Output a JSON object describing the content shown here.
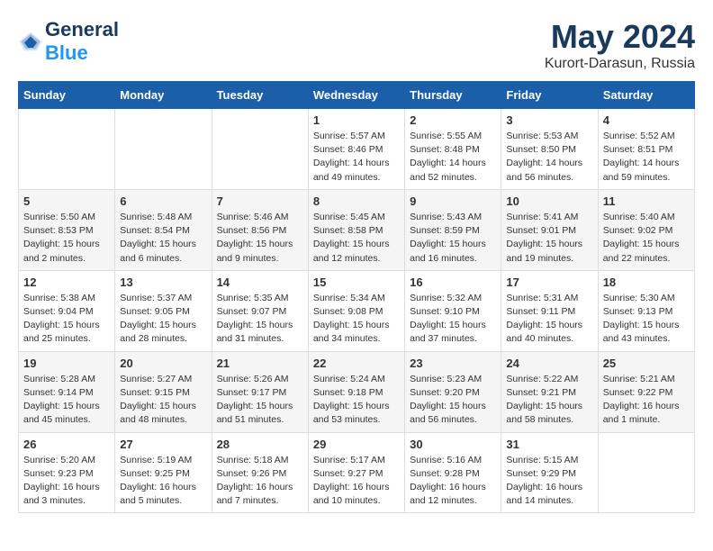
{
  "logo": {
    "text_general": "General",
    "text_blue": "Blue"
  },
  "title": "May 2024",
  "location": "Kurort-Darasun, Russia",
  "weekdays": [
    "Sunday",
    "Monday",
    "Tuesday",
    "Wednesday",
    "Thursday",
    "Friday",
    "Saturday"
  ],
  "weeks": [
    [
      {
        "day": "",
        "sunrise": "",
        "sunset": "",
        "daylight": ""
      },
      {
        "day": "",
        "sunrise": "",
        "sunset": "",
        "daylight": ""
      },
      {
        "day": "",
        "sunrise": "",
        "sunset": "",
        "daylight": ""
      },
      {
        "day": "1",
        "sunrise": "Sunrise: 5:57 AM",
        "sunset": "Sunset: 8:46 PM",
        "daylight": "Daylight: 14 hours and 49 minutes."
      },
      {
        "day": "2",
        "sunrise": "Sunrise: 5:55 AM",
        "sunset": "Sunset: 8:48 PM",
        "daylight": "Daylight: 14 hours and 52 minutes."
      },
      {
        "day": "3",
        "sunrise": "Sunrise: 5:53 AM",
        "sunset": "Sunset: 8:50 PM",
        "daylight": "Daylight: 14 hours and 56 minutes."
      },
      {
        "day": "4",
        "sunrise": "Sunrise: 5:52 AM",
        "sunset": "Sunset: 8:51 PM",
        "daylight": "Daylight: 14 hours and 59 minutes."
      }
    ],
    [
      {
        "day": "5",
        "sunrise": "Sunrise: 5:50 AM",
        "sunset": "Sunset: 8:53 PM",
        "daylight": "Daylight: 15 hours and 2 minutes."
      },
      {
        "day": "6",
        "sunrise": "Sunrise: 5:48 AM",
        "sunset": "Sunset: 8:54 PM",
        "daylight": "Daylight: 15 hours and 6 minutes."
      },
      {
        "day": "7",
        "sunrise": "Sunrise: 5:46 AM",
        "sunset": "Sunset: 8:56 PM",
        "daylight": "Daylight: 15 hours and 9 minutes."
      },
      {
        "day": "8",
        "sunrise": "Sunrise: 5:45 AM",
        "sunset": "Sunset: 8:58 PM",
        "daylight": "Daylight: 15 hours and 12 minutes."
      },
      {
        "day": "9",
        "sunrise": "Sunrise: 5:43 AM",
        "sunset": "Sunset: 8:59 PM",
        "daylight": "Daylight: 15 hours and 16 minutes."
      },
      {
        "day": "10",
        "sunrise": "Sunrise: 5:41 AM",
        "sunset": "Sunset: 9:01 PM",
        "daylight": "Daylight: 15 hours and 19 minutes."
      },
      {
        "day": "11",
        "sunrise": "Sunrise: 5:40 AM",
        "sunset": "Sunset: 9:02 PM",
        "daylight": "Daylight: 15 hours and 22 minutes."
      }
    ],
    [
      {
        "day": "12",
        "sunrise": "Sunrise: 5:38 AM",
        "sunset": "Sunset: 9:04 PM",
        "daylight": "Daylight: 15 hours and 25 minutes."
      },
      {
        "day": "13",
        "sunrise": "Sunrise: 5:37 AM",
        "sunset": "Sunset: 9:05 PM",
        "daylight": "Daylight: 15 hours and 28 minutes."
      },
      {
        "day": "14",
        "sunrise": "Sunrise: 5:35 AM",
        "sunset": "Sunset: 9:07 PM",
        "daylight": "Daylight: 15 hours and 31 minutes."
      },
      {
        "day": "15",
        "sunrise": "Sunrise: 5:34 AM",
        "sunset": "Sunset: 9:08 PM",
        "daylight": "Daylight: 15 hours and 34 minutes."
      },
      {
        "day": "16",
        "sunrise": "Sunrise: 5:32 AM",
        "sunset": "Sunset: 9:10 PM",
        "daylight": "Daylight: 15 hours and 37 minutes."
      },
      {
        "day": "17",
        "sunrise": "Sunrise: 5:31 AM",
        "sunset": "Sunset: 9:11 PM",
        "daylight": "Daylight: 15 hours and 40 minutes."
      },
      {
        "day": "18",
        "sunrise": "Sunrise: 5:30 AM",
        "sunset": "Sunset: 9:13 PM",
        "daylight": "Daylight: 15 hours and 43 minutes."
      }
    ],
    [
      {
        "day": "19",
        "sunrise": "Sunrise: 5:28 AM",
        "sunset": "Sunset: 9:14 PM",
        "daylight": "Daylight: 15 hours and 45 minutes."
      },
      {
        "day": "20",
        "sunrise": "Sunrise: 5:27 AM",
        "sunset": "Sunset: 9:15 PM",
        "daylight": "Daylight: 15 hours and 48 minutes."
      },
      {
        "day": "21",
        "sunrise": "Sunrise: 5:26 AM",
        "sunset": "Sunset: 9:17 PM",
        "daylight": "Daylight: 15 hours and 51 minutes."
      },
      {
        "day": "22",
        "sunrise": "Sunrise: 5:24 AM",
        "sunset": "Sunset: 9:18 PM",
        "daylight": "Daylight: 15 hours and 53 minutes."
      },
      {
        "day": "23",
        "sunrise": "Sunrise: 5:23 AM",
        "sunset": "Sunset: 9:20 PM",
        "daylight": "Daylight: 15 hours and 56 minutes."
      },
      {
        "day": "24",
        "sunrise": "Sunrise: 5:22 AM",
        "sunset": "Sunset: 9:21 PM",
        "daylight": "Daylight: 15 hours and 58 minutes."
      },
      {
        "day": "25",
        "sunrise": "Sunrise: 5:21 AM",
        "sunset": "Sunset: 9:22 PM",
        "daylight": "Daylight: 16 hours and 1 minute."
      }
    ],
    [
      {
        "day": "26",
        "sunrise": "Sunrise: 5:20 AM",
        "sunset": "Sunset: 9:23 PM",
        "daylight": "Daylight: 16 hours and 3 minutes."
      },
      {
        "day": "27",
        "sunrise": "Sunrise: 5:19 AM",
        "sunset": "Sunset: 9:25 PM",
        "daylight": "Daylight: 16 hours and 5 minutes."
      },
      {
        "day": "28",
        "sunrise": "Sunrise: 5:18 AM",
        "sunset": "Sunset: 9:26 PM",
        "daylight": "Daylight: 16 hours and 7 minutes."
      },
      {
        "day": "29",
        "sunrise": "Sunrise: 5:17 AM",
        "sunset": "Sunset: 9:27 PM",
        "daylight": "Daylight: 16 hours and 10 minutes."
      },
      {
        "day": "30",
        "sunrise": "Sunrise: 5:16 AM",
        "sunset": "Sunset: 9:28 PM",
        "daylight": "Daylight: 16 hours and 12 minutes."
      },
      {
        "day": "31",
        "sunrise": "Sunrise: 5:15 AM",
        "sunset": "Sunset: 9:29 PM",
        "daylight": "Daylight: 16 hours and 14 minutes."
      },
      {
        "day": "",
        "sunrise": "",
        "sunset": "",
        "daylight": ""
      }
    ]
  ]
}
